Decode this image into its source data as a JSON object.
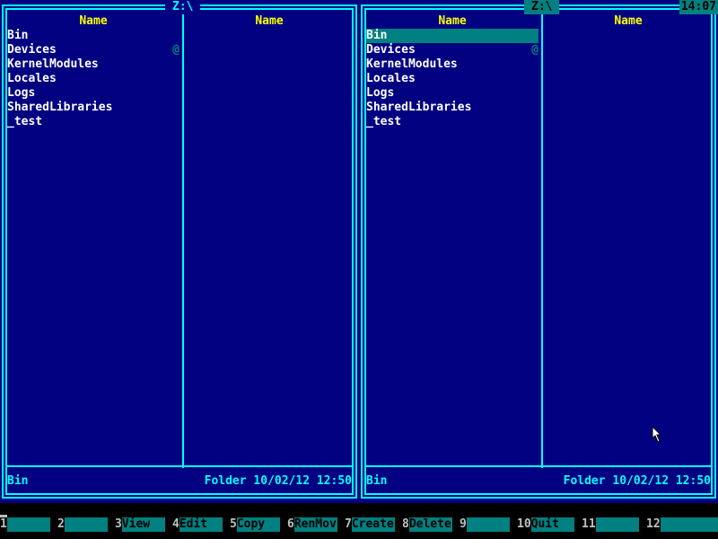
{
  "clock": "14:07",
  "panels": {
    "left": {
      "title": "Z:\\",
      "active": false,
      "column_headers": [
        "Name",
        "Name"
      ],
      "files": [
        {
          "name": "Bin",
          "link": ""
        },
        {
          "name": "Devices",
          "link": "@"
        },
        {
          "name": "KernelModules",
          "link": ""
        },
        {
          "name": "Locales",
          "link": ""
        },
        {
          "name": "Logs",
          "link": ""
        },
        {
          "name": "SharedLibraries",
          "link": ""
        },
        {
          "name": "_test",
          "link": ""
        }
      ],
      "status": {
        "name": "Bin",
        "info": "Folder 10/02/12 12:50"
      }
    },
    "right": {
      "title": "Z:\\",
      "active": true,
      "selected_index": 0,
      "column_headers": [
        "Name",
        "Name"
      ],
      "files": [
        {
          "name": "Bin",
          "link": ""
        },
        {
          "name": "Devices",
          "link": "@"
        },
        {
          "name": "KernelModules",
          "link": ""
        },
        {
          "name": "Locales",
          "link": ""
        },
        {
          "name": "Logs",
          "link": ""
        },
        {
          "name": "SharedLibraries",
          "link": ""
        },
        {
          "name": "_test",
          "link": ""
        }
      ],
      "status": {
        "name": "Bin",
        "info": "Folder 10/02/12 12:50"
      }
    }
  },
  "function_keys": [
    {
      "num": "1",
      "label": ""
    },
    {
      "num": "2",
      "label": ""
    },
    {
      "num": "3",
      "label": "View"
    },
    {
      "num": "4",
      "label": "Edit"
    },
    {
      "num": "5",
      "label": "Copy"
    },
    {
      "num": "6",
      "label": "RenMov"
    },
    {
      "num": "7",
      "label": "Create"
    },
    {
      "num": "8",
      "label": "Delete"
    },
    {
      "num": "9",
      "label": ""
    },
    {
      "num": "10",
      "label": "Quit"
    },
    {
      "num": "11",
      "label": ""
    },
    {
      "num": "12",
      "label": ""
    }
  ],
  "colors": {
    "panel_bg": "#000080",
    "border": "#00ffff",
    "header_text": "#ffff00",
    "file_text": "#ffffff",
    "highlight": "#008080"
  }
}
